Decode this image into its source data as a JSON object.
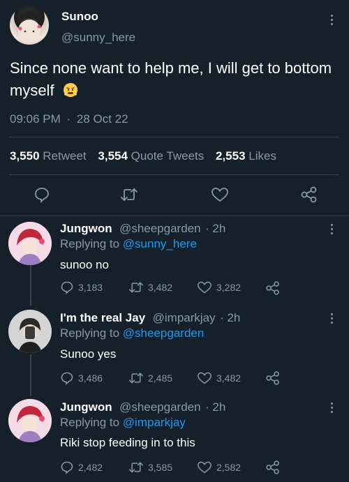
{
  "main_tweet": {
    "name": "Sunoo",
    "handle": "@sunny_here",
    "text": "Since none want to help me, I will get to bottom myself",
    "emoji": "😤",
    "time": "09:06 PM",
    "date_sep": "·",
    "date": "28 Oct 22",
    "stats": [
      {
        "count": "3,550",
        "label": "Retweet"
      },
      {
        "count": "3,554",
        "label": "Quote Tweets"
      },
      {
        "count": "2,553",
        "label": "Likes"
      }
    ]
  },
  "replies": [
    {
      "name": "Jungwon",
      "handle": "@sheepgarden",
      "time": "· 2h",
      "replying_label": "Replying to",
      "replying_to": "@sunny_here",
      "text": "sunoo no",
      "replies": "3,183",
      "retweets": "3,482",
      "likes": "3,282"
    },
    {
      "name": "I'm the real Jay",
      "handle": "@imparkjay",
      "time": "· 2h",
      "replying_label": "Replying to",
      "replying_to": "@sheepgarden",
      "text": "Sunoo yes",
      "replies": "3,486",
      "retweets": "2,485",
      "likes": "3,482"
    },
    {
      "name": "Jungwon",
      "handle": "@sheepgarden",
      "time": "· 2h",
      "replying_label": "Replying to",
      "replying_to": "@imparkjay",
      "text": "Riki stop feeding in to this",
      "replies": "2,482",
      "retweets": "3,585",
      "likes": "2,582"
    }
  ],
  "colors": {
    "background": "#15202b",
    "muted": "#8899a6",
    "link": "#1d9bf0",
    "divider": "#38444d"
  },
  "icons": [
    "reply-icon",
    "retweet-icon",
    "like-icon",
    "share-icon",
    "more-icon"
  ]
}
